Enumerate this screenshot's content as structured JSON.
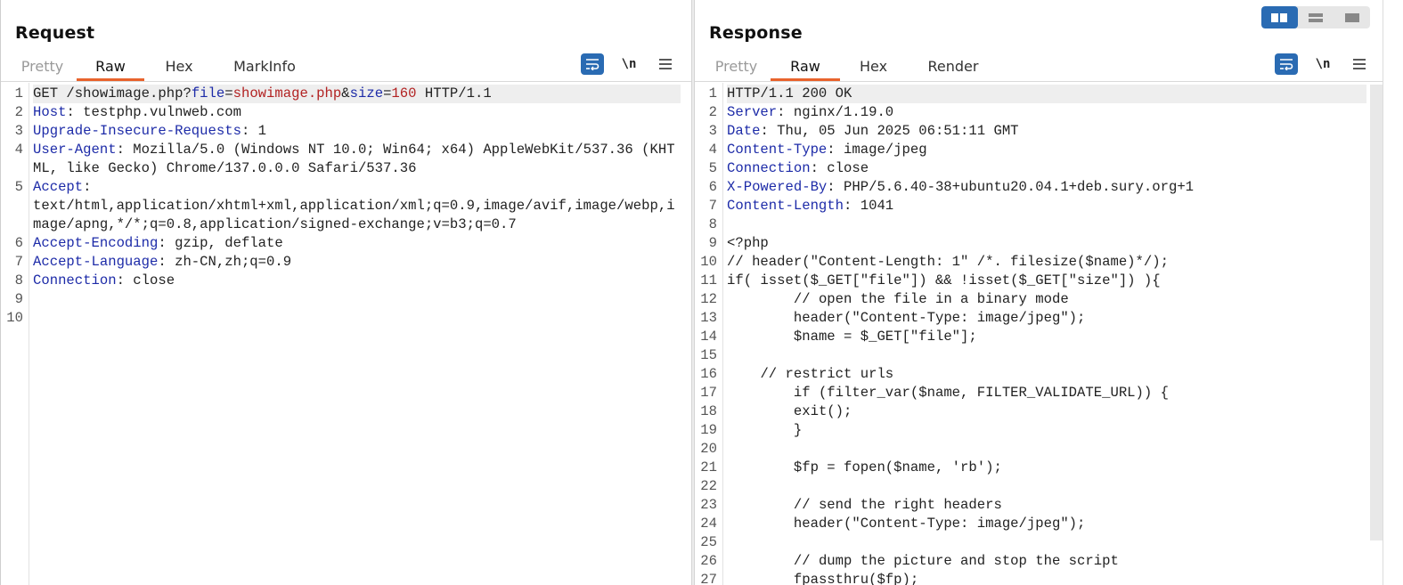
{
  "request": {
    "title": "Request",
    "tabs": [
      "Pretty",
      "Raw",
      "Hex",
      "MarkInfo"
    ],
    "active_tab": "Raw",
    "tool_newline_label": "\\n",
    "lines": [
      {
        "n": "1",
        "segs": [
          [
            "GET /showimage.php?",
            ""
          ],
          [
            "file",
            "k"
          ],
          [
            "=",
            ""
          ],
          [
            "showimage.php",
            "v"
          ],
          [
            "&",
            ""
          ],
          [
            "size",
            "k"
          ],
          [
            "=",
            ""
          ],
          [
            "160",
            "v"
          ],
          [
            " HTTP/1.1",
            ""
          ]
        ]
      },
      {
        "n": "2",
        "segs": [
          [
            "Host",
            "k"
          ],
          [
            ": testphp.vulnweb.com",
            ""
          ]
        ]
      },
      {
        "n": "3",
        "segs": [
          [
            "Upgrade-Insecure-Requests",
            "k"
          ],
          [
            ": 1",
            ""
          ]
        ]
      },
      {
        "n": "4",
        "segs": [
          [
            "User-Agent",
            "k"
          ],
          [
            ": Mozilla/5.0 (Windows NT 10.0; Win64; x64) AppleWebKit/537.36 (KHTML, like Gecko) Chrome/137.0.0.0 Safari/537.36",
            ""
          ]
        ]
      },
      {
        "n": "5",
        "segs": [
          [
            "Accept",
            "k"
          ],
          [
            ":\ntext/html,application/xhtml+xml,application/xml;q=0.9,image/avif,image/webp,image/apng,*/*;q=0.8,application/signed-exchange;v=b3;q=0.7",
            ""
          ]
        ]
      },
      {
        "n": "6",
        "segs": [
          [
            "Accept-Encoding",
            "k"
          ],
          [
            ": gzip, deflate",
            ""
          ]
        ]
      },
      {
        "n": "7",
        "segs": [
          [
            "Accept-Language",
            "k"
          ],
          [
            ": zh-CN,zh;q=0.9",
            ""
          ]
        ]
      },
      {
        "n": "8",
        "segs": [
          [
            "Connection",
            "k"
          ],
          [
            ": close",
            ""
          ]
        ]
      },
      {
        "n": "9",
        "segs": [
          [
            "",
            ""
          ]
        ]
      },
      {
        "n": "10",
        "segs": [
          [
            "",
            ""
          ]
        ]
      }
    ]
  },
  "response": {
    "title": "Response",
    "tabs": [
      "Pretty",
      "Raw",
      "Hex",
      "Render"
    ],
    "active_tab": "Raw",
    "tool_newline_label": "\\n",
    "lines": [
      {
        "n": "1",
        "segs": [
          [
            "HTTP/1.1 200 OK",
            ""
          ]
        ]
      },
      {
        "n": "2",
        "segs": [
          [
            "Server",
            "k"
          ],
          [
            ": nginx/1.19.0",
            ""
          ]
        ]
      },
      {
        "n": "3",
        "segs": [
          [
            "Date",
            "k"
          ],
          [
            ": Thu, 05 Jun 2025 06:51:11 GMT",
            ""
          ]
        ]
      },
      {
        "n": "4",
        "segs": [
          [
            "Content-Type",
            "k"
          ],
          [
            ": image/jpeg",
            ""
          ]
        ]
      },
      {
        "n": "5",
        "segs": [
          [
            "Connection",
            "k"
          ],
          [
            ": close",
            ""
          ]
        ]
      },
      {
        "n": "6",
        "segs": [
          [
            "X-Powered-By",
            "k"
          ],
          [
            ": PHP/5.6.40-38+ubuntu20.04.1+deb.sury.org+1",
            ""
          ]
        ]
      },
      {
        "n": "7",
        "segs": [
          [
            "Content-Length",
            "k"
          ],
          [
            ": 1041",
            ""
          ]
        ]
      },
      {
        "n": "8",
        "segs": [
          [
            "",
            ""
          ]
        ]
      },
      {
        "n": "9",
        "segs": [
          [
            "<?php",
            ""
          ]
        ]
      },
      {
        "n": "10",
        "segs": [
          [
            "// header(\"Content-Length: 1\" /*. filesize($name)*/);",
            ""
          ]
        ]
      },
      {
        "n": "11",
        "segs": [
          [
            "if( isset($_GET[\"file\"]) && !isset($_GET[\"size\"]) ){",
            ""
          ]
        ]
      },
      {
        "n": "12",
        "segs": [
          [
            "        // open the file in a binary mode",
            ""
          ]
        ]
      },
      {
        "n": "13",
        "segs": [
          [
            "        header(\"Content-Type: image/jpeg\");",
            ""
          ]
        ]
      },
      {
        "n": "14",
        "segs": [
          [
            "        $name = $_GET[\"file\"];",
            ""
          ]
        ]
      },
      {
        "n": "15",
        "segs": [
          [
            "",
            ""
          ]
        ]
      },
      {
        "n": "16",
        "segs": [
          [
            "    // restrict urls",
            ""
          ]
        ]
      },
      {
        "n": "17",
        "segs": [
          [
            "        if (filter_var($name, FILTER_VALIDATE_URL)) {",
            ""
          ]
        ]
      },
      {
        "n": "18",
        "segs": [
          [
            "        exit();",
            ""
          ]
        ]
      },
      {
        "n": "19",
        "segs": [
          [
            "        }",
            ""
          ]
        ]
      },
      {
        "n": "20",
        "segs": [
          [
            "",
            ""
          ]
        ]
      },
      {
        "n": "21",
        "segs": [
          [
            "        $fp = fopen($name, 'rb');",
            ""
          ]
        ]
      },
      {
        "n": "22",
        "segs": [
          [
            "",
            ""
          ]
        ]
      },
      {
        "n": "23",
        "segs": [
          [
            "        // send the right headers",
            ""
          ]
        ]
      },
      {
        "n": "24",
        "segs": [
          [
            "        header(\"Content-Type: image/jpeg\");",
            ""
          ]
        ]
      },
      {
        "n": "25",
        "segs": [
          [
            "",
            ""
          ]
        ]
      },
      {
        "n": "26",
        "segs": [
          [
            "        // dump the picture and stop the script",
            ""
          ]
        ]
      },
      {
        "n": "27",
        "segs": [
          [
            "        fpassthru($fp);",
            ""
          ]
        ]
      }
    ]
  },
  "layout_switch": {
    "options": [
      "side-by-side-icon",
      "stacked-icon",
      "single-pane-icon"
    ],
    "selected": "side-by-side-icon"
  },
  "colors": {
    "accent_tab": "#e8632c",
    "tool_button": "#2a6bb3",
    "header_key": "#1d2ba8",
    "param_value": "#b22222"
  }
}
